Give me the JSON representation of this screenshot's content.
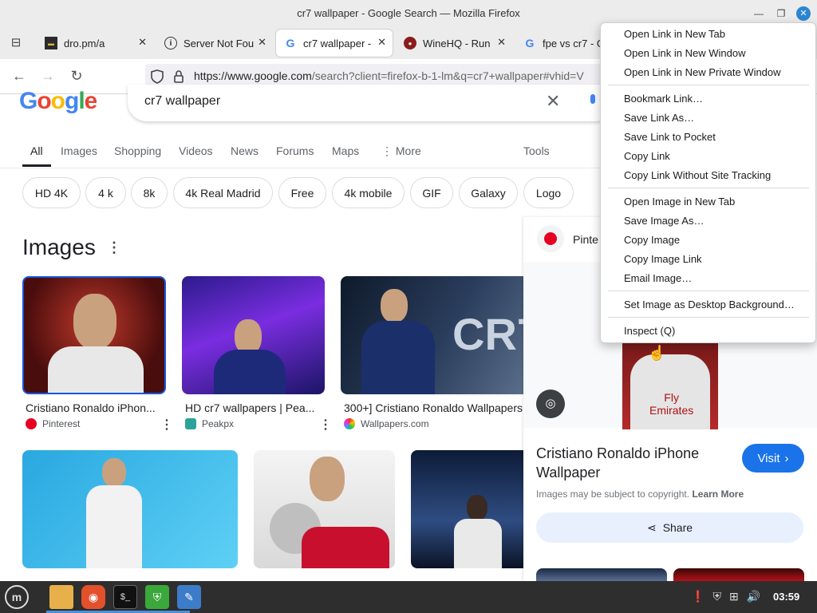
{
  "window": {
    "title": "cr7 wallpaper - Google Search — Mozilla Firefox"
  },
  "tabs": [
    {
      "label": "dro.pm/a",
      "icon": "terminal-favicon-icon"
    },
    {
      "label": "Server Not Fou",
      "icon": "info-icon"
    },
    {
      "label": "cr7 wallpaper -",
      "icon": "google-favicon-icon"
    },
    {
      "label": "WineHQ - Run",
      "icon": "wine-favicon-icon"
    },
    {
      "label": "fpe vs cr7 - G",
      "icon": "google-favicon-icon"
    }
  ],
  "url": {
    "host": "https://www.google.com",
    "path": "/search?client=firefox-b-1-lm&q=cr7+wallpaper#vhid=V"
  },
  "google": {
    "logo": "Google",
    "query": "cr7 wallpaper",
    "tabs": [
      "All",
      "Images",
      "Shopping",
      "Videos",
      "News",
      "Forums",
      "Maps",
      "More"
    ],
    "tools": "Tools",
    "chips": [
      "HD 4K",
      "4 k",
      "8k",
      "4k Real Madrid",
      "Free",
      "4k mobile",
      "GIF",
      "Galaxy",
      "Logo"
    ],
    "images_heading": "Images",
    "results": [
      {
        "caption": "Cristiano Ronaldo iPhon...",
        "source": "Pinterest"
      },
      {
        "caption": "HD cr7 wallpapers | Pea...",
        "source": "Peakpx"
      },
      {
        "caption": "300+] Cristiano Ronaldo Wallpapers",
        "source": "Wallpapers.com"
      }
    ],
    "banner_text": "CR7"
  },
  "side_panel": {
    "source": "Pinte",
    "title_line1": "Cristiano Ronaldo iPhone",
    "title_line2": "Wallpaper",
    "visit": "Visit",
    "copyright": "Images may be subject to copyright.",
    "learn_more": "Learn More",
    "share": "Share",
    "jersey_text": "Fly\nEmirates"
  },
  "context_menu": {
    "groups": [
      [
        "Open Link in New Tab",
        "Open Link in New Window",
        "Open Link in New Private Window"
      ],
      [
        "Bookmark Link…",
        "Save Link As…",
        "Save Link to Pocket",
        "Copy Link",
        "Copy Link Without Site Tracking"
      ],
      [
        "Open Image in New Tab",
        "Save Image As…",
        "Copy Image",
        "Copy Image Link",
        "Email Image…"
      ],
      [
        "Set Image as Desktop Background…"
      ],
      [
        "Inspect (Q)"
      ]
    ]
  },
  "taskbar": {
    "clock": "03:59"
  },
  "colors": {
    "google_blue": "#1a73e8",
    "titlebar": "#ececec",
    "taskbar": "#2e2e2e"
  }
}
